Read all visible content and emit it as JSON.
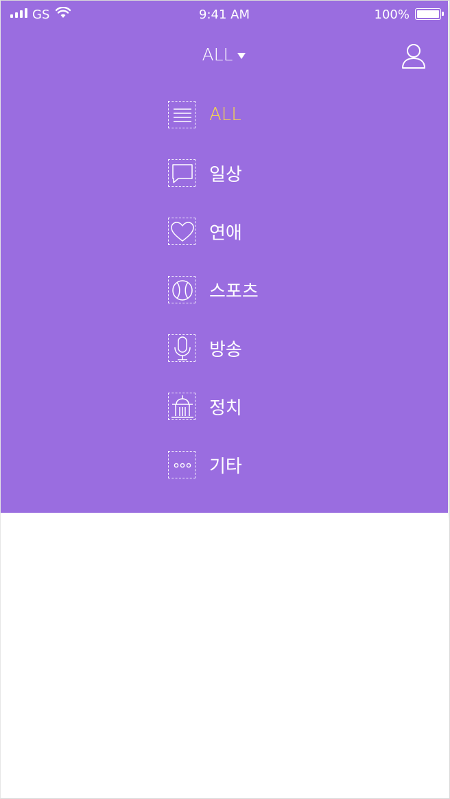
{
  "status_bar": {
    "carrier": "GS",
    "time": "9:41 AM",
    "battery": "100%"
  },
  "header": {
    "title": "ALL"
  },
  "menu": {
    "active_color": "#f6d84a",
    "items": [
      {
        "label": "ALL",
        "icon": "list-icon",
        "active": true
      },
      {
        "label": "일상",
        "icon": "chat-bubble-icon"
      },
      {
        "label": "연애",
        "icon": "heart-icon"
      },
      {
        "label": "스포츠",
        "icon": "ball-icon"
      },
      {
        "label": "방송",
        "icon": "microphone-icon"
      },
      {
        "label": "정치",
        "icon": "government-building-icon"
      },
      {
        "label": "기타",
        "icon": "more-dots-icon"
      }
    ]
  },
  "colors": {
    "panel": "#9a6de0",
    "text": "#ffffff"
  }
}
